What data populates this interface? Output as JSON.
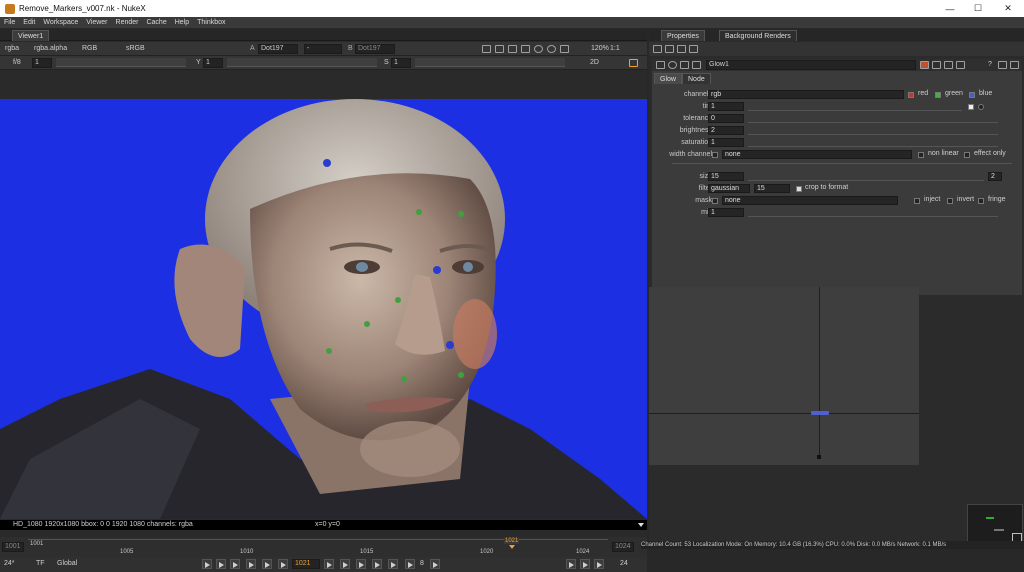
{
  "window": {
    "title": "Remove_Markers_v007.nk - NukeX",
    "minimize": "—",
    "maximize": "☐",
    "close": "✕"
  },
  "menu": [
    "File",
    "Edit",
    "Workspace",
    "Viewer",
    "Render",
    "Cache",
    "Help",
    "Thinkbox"
  ],
  "viewer": {
    "tab": "Viewer1",
    "channels": "rgba",
    "alpha": "rgba.alpha",
    "rgb": "RGB",
    "colorspace": "sRGB",
    "a_input": "Dot197",
    "a_op": "-",
    "b_input": "Dot197",
    "zoom": "120%",
    "ratio": "1:1",
    "fstop": "f/8",
    "gain": "1",
    "y_label": "Y",
    "gamma": "1",
    "s_label": "S",
    "sat": "1",
    "mode2d": "2D",
    "info": "HD_1080 1920x1080  bbox: 0 0 1920 1080 channels: rgba",
    "coords": "x=0 y=0"
  },
  "timeline": {
    "start": "1001",
    "end": "1024",
    "ticks": [
      "1001",
      "1005",
      "1010",
      "1015",
      "1020",
      "1024"
    ],
    "current": "1021",
    "fps": "24*",
    "tf": "TF",
    "global": "Global",
    "frame": "1021",
    "step": "8",
    "end_frame": "24"
  },
  "properties": {
    "tab": "Properties",
    "tab2": "Background Renders",
    "node_name": "Glow1",
    "node_tabs": [
      "Glow",
      "Node"
    ],
    "knobs": {
      "channels_label": "channels",
      "channels_val": "rgb",
      "red": "red",
      "green": "green",
      "blue": "blue",
      "tint_label": "tint",
      "tint_val": "1",
      "tolerance_label": "tolerance",
      "tolerance_val": "0",
      "brightness_label": "brightness",
      "brightness_val": "2",
      "saturation_label": "saturation",
      "saturation_val": "1",
      "width_label": "width channel",
      "width_val": "none",
      "nonlinear": "non linear",
      "effectonly": "effect only",
      "size_label": "size",
      "size_val": "15",
      "filter_label": "filter",
      "filter_val": "gaussian",
      "filter_num": "15",
      "crop": "crop to format",
      "mask_label": "mask",
      "mask_val": "none",
      "inject": "inject",
      "invert": "invert",
      "fringe": "fringe",
      "mix_label": "mix",
      "mix_val": "1"
    }
  },
  "status": "Channel Count: 53  Localization Mode: On  Memory: 10.4 GB (16.3%)  CPU: 0.0%  Disk: 0.0 MB/s  Network: 0.1 MB/s",
  "colors": {
    "bluescreen": "#1c2fe3",
    "accent": "#f0a030"
  }
}
